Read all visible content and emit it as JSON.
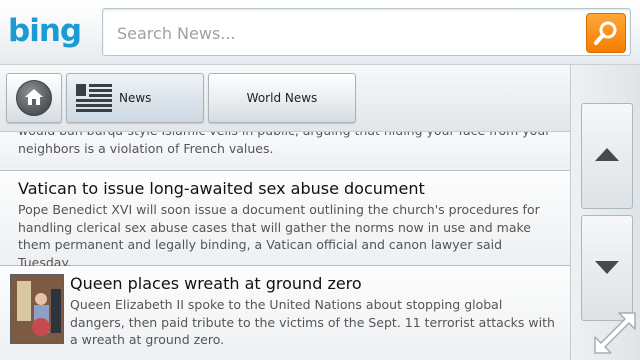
{
  "header": {
    "logo_text": "bing",
    "search": {
      "placeholder": "Search News...",
      "value": ""
    },
    "search_button_icon": "search-icon",
    "accent_color": "#f78c0e",
    "brand_color": "#1a9bd3"
  },
  "nav": {
    "home_icon": "home-icon",
    "tabs": [
      {
        "label": "News",
        "icon": "news-list-icon"
      },
      {
        "label": "World News"
      }
    ]
  },
  "articles": [
    {
      "snippet": "would ban burqa-style Islamic veils in public, arguing that hiding your face from your neighbors is a violation of French values."
    },
    {
      "headline": "Vatican to issue long-awaited sex abuse document",
      "snippet": "Pope Benedict XVI will soon issue a document outlining the church's procedures for handling clerical sex abuse cases that will gather the norms now in use and make them permanent and legally binding, a Vatican official and canon lawyer said Tuesday."
    },
    {
      "headline": "Queen places wreath at ground zero",
      "snippet": "Queen Elizabeth II spoke to the United Nations about stopping global dangers, then paid tribute to the victims of the Sept. 11 terrorist attacks with a wreath at ground zero.",
      "thumbnail": "queen-photo"
    }
  ],
  "sidebar": {
    "scroll_up_icon": "arrow-up-icon",
    "scroll_down_icon": "arrow-down-icon",
    "expand_icon": "expand-diagonal-icon"
  }
}
